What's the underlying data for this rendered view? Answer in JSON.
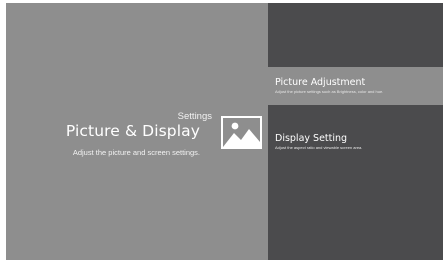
{
  "header": {
    "section_label": "Settings",
    "title": "Picture & Display",
    "subtitle": "Adjust the picture and screen settings."
  },
  "icons": {
    "category": "picture-icon"
  },
  "menu": {
    "items": [
      {
        "title": "Picture Adjustment",
        "description": "Adjust the picture settings such as Brightness, color and hue.",
        "selected": true
      },
      {
        "title": "Display Setting",
        "description": "Adjust the aspect ratio and viewable screen area.",
        "selected": false
      }
    ]
  },
  "colors": {
    "left_background": "#8e8e8e",
    "right_background": "#4b4b4d",
    "selected_item": "#8e8e8e",
    "text": "#ffffff"
  }
}
